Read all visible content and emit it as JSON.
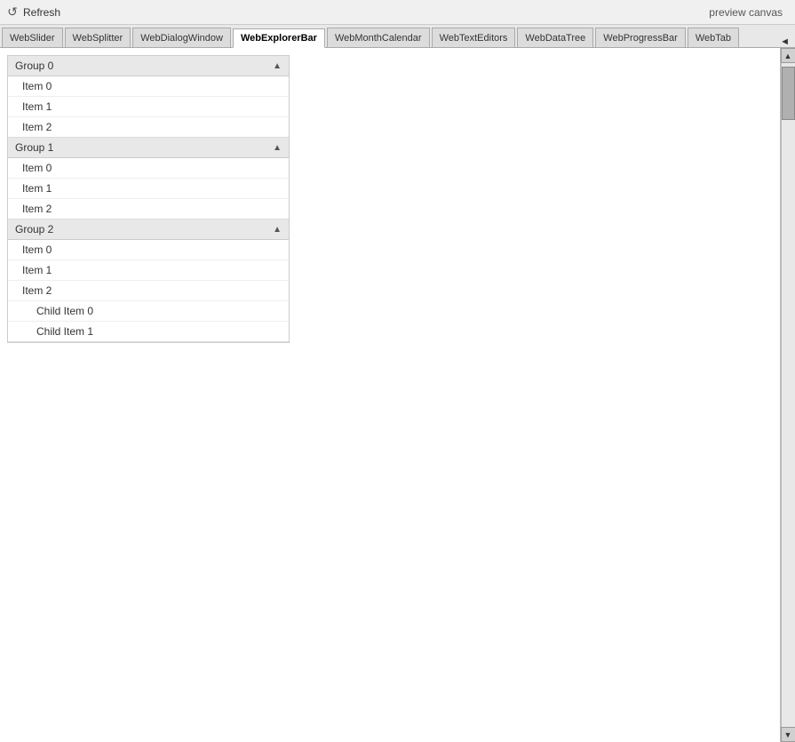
{
  "topbar": {
    "refresh_label": "Refresh",
    "preview_canvas_label": "preview canvas",
    "refresh_icon": "↺"
  },
  "tabs": [
    {
      "id": "webslider",
      "label": "WebSlider",
      "active": false
    },
    {
      "id": "websplitter",
      "label": "WebSplitter",
      "active": false
    },
    {
      "id": "webdialogwindow",
      "label": "WebDialogWindow",
      "active": false
    },
    {
      "id": "webexplorerbar",
      "label": "WebExplorerBar",
      "active": true
    },
    {
      "id": "webmonthcalendar",
      "label": "WebMonthCalendar",
      "active": false
    },
    {
      "id": "webtexteditors",
      "label": "WebTextEditors",
      "active": false
    },
    {
      "id": "webdatatree",
      "label": "WebDataTree",
      "active": false
    },
    {
      "id": "webprogressbar",
      "label": "WebProgressBar",
      "active": false
    },
    {
      "id": "webtab",
      "label": "WebTab",
      "active": false
    }
  ],
  "tab_arrow": "◄",
  "explorer": {
    "groups": [
      {
        "id": "group0",
        "label": "Group 0",
        "expanded": true,
        "items": [
          {
            "label": "Item 0",
            "children": []
          },
          {
            "label": "Item 1",
            "children": []
          },
          {
            "label": "Item 2",
            "children": []
          }
        ]
      },
      {
        "id": "group1",
        "label": "Group 1",
        "expanded": true,
        "items": [
          {
            "label": "Item 0",
            "children": []
          },
          {
            "label": "Item 1",
            "children": []
          },
          {
            "label": "Item 2",
            "children": []
          }
        ]
      },
      {
        "id": "group2",
        "label": "Group 2",
        "expanded": true,
        "items": [
          {
            "label": "Item 0",
            "children": []
          },
          {
            "label": "Item 1",
            "children": []
          },
          {
            "label": "Item 2",
            "children": [
              {
                "label": "Child Item 0"
              },
              {
                "label": "Child Item 1"
              }
            ]
          }
        ]
      }
    ]
  }
}
